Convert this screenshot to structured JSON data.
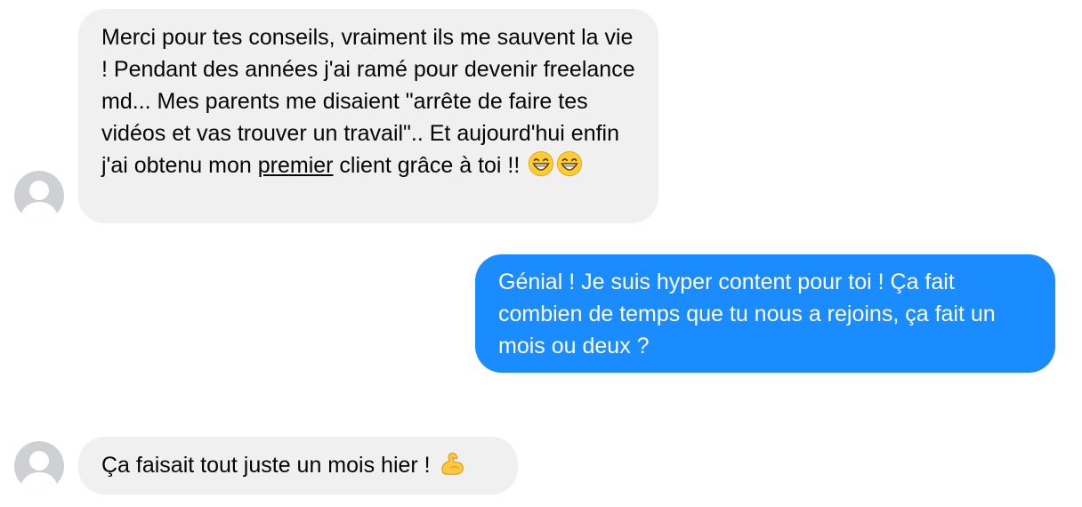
{
  "conversation": {
    "messages": [
      {
        "sender": "contact",
        "text_before": "Merci pour tes conseils, vraiment ils me sauvent la vie ! Pendant des années j'ai ramé pour devenir freelance md... Mes parents me disaient \"arrête de faire tes vidéos et vas trouver un travail\".. Et aujourd'hui enfin j'ai obtenu mon ",
        "underlined": "premier",
        "text_after": " client grâce à toi !! ",
        "emojis": [
          "grinning-face-emoji",
          "grinning-face-emoji"
        ]
      },
      {
        "sender": "me",
        "text": "Génial ! Je suis hyper content pour toi ! Ça fait combien de temps que tu nous a rejoins, ça fait un mois ou deux ?"
      },
      {
        "sender": "contact",
        "text": "Ça faisait tout juste un mois hier ! ",
        "emojis": [
          "flexed-biceps-emoji"
        ]
      }
    ]
  },
  "colors": {
    "incoming_bubble": "#f0f0f0",
    "outgoing_bubble": "#1a8cff",
    "outgoing_text": "#ffffff",
    "incoming_text": "#050505",
    "avatar_placeholder": "#ced0d4"
  }
}
